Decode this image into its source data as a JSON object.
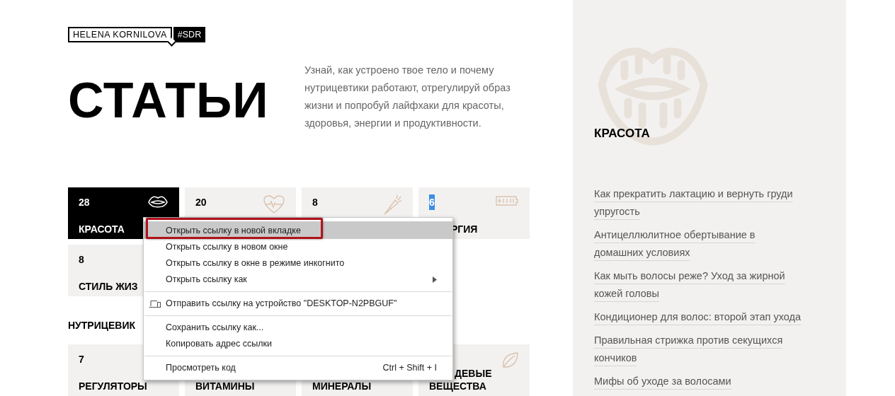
{
  "logo": {
    "name": "HELENA KORNILOVA",
    "tag": "#SDR"
  },
  "title": "СТАТЬИ",
  "intro": "Узнай, как устроено твое тело и почему нутрицевтики работают, отрегулируй образ жизни и попробуй лайфхаки для красоты, здоровья, энергии и продуктивности.",
  "tile_rows": [
    [
      {
        "count": "28",
        "label_lines": [
          "КРАСОТА"
        ],
        "selected": true,
        "count_highlighted": false
      },
      {
        "count": "20",
        "selected": false,
        "count_highlighted": false
      },
      {
        "count": "8",
        "selected": false,
        "count_highlighted": false
      },
      {
        "count": "6",
        "label_lines": [
          "РГИЯ"
        ],
        "selected": false,
        "count_highlighted": true
      }
    ],
    [
      {
        "count": "8",
        "label_lines": [
          "СТИЛЬ ЖИЗ"
        ],
        "selected": false,
        "count_highlighted": false
      }
    ]
  ],
  "section_heading": "НУТРИЦЕВИК",
  "section_tiles": [
    {
      "count": "7",
      "label_lines": [
        "РЕГУЛЯТОРЫ"
      ],
      "selected": false,
      "count_highlighted": false
    },
    {
      "label_lines": [
        "ВИТАМИНЫ"
      ],
      "selected": false
    },
    {
      "label_lines": [
        "МИНЕРАЛЫ"
      ],
      "selected": false
    },
    {
      "label_lines": [
        "ДЕВЫЕ",
        "ВЕЩЕСТВА"
      ],
      "selected": false
    }
  ],
  "sidebar": {
    "heading": "КРАСОТА",
    "links": [
      "Как прекратить лактацию и вернуть груди упругость",
      "Антицеллюлитное обертывание в домашних условиях",
      "Как мыть волосы реже? Уход за жирной кожей головы",
      "Кондиционер для волос: второй этап ухода",
      "Правильная стрижка против секущихся кончиков",
      "Мифы об уходе за волосами"
    ]
  },
  "context_menu": {
    "items": [
      {
        "kind": "item",
        "label": "Открыть ссылку в новой вкладке",
        "selected": true
      },
      {
        "kind": "item",
        "label": "Открыть ссылку в новом окне",
        "selected": false
      },
      {
        "kind": "item",
        "label": "Открыть ссылку в окне в режиме инкогнито",
        "selected": false
      },
      {
        "kind": "submenu",
        "label": "Открыть ссылку как",
        "selected": false
      },
      {
        "kind": "separator"
      },
      {
        "kind": "device",
        "label": "Отправить ссылку на устройство \"DESKTOP-N2PBGUF\"",
        "selected": false
      },
      {
        "kind": "separator"
      },
      {
        "kind": "item",
        "label": "Сохранить ссылку как...",
        "selected": false
      },
      {
        "kind": "item",
        "label": "Копировать адрес ссылки",
        "selected": false
      },
      {
        "kind": "separator"
      },
      {
        "kind": "item",
        "label": "Просмотреть код",
        "shortcut": "Ctrl + Shift + I",
        "selected": false
      }
    ]
  }
}
